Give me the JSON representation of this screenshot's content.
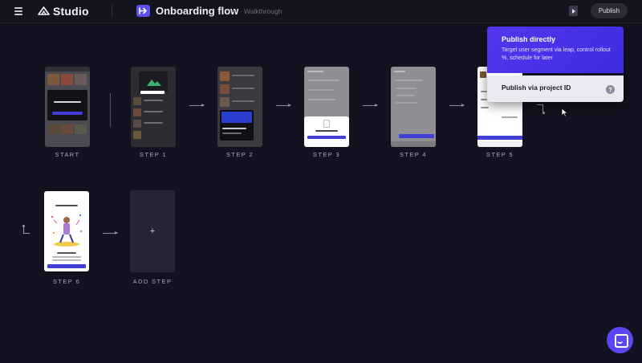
{
  "app": {
    "brand": "Studio",
    "flow_title": "Onboarding flow",
    "flow_type": "Walkthrough",
    "publish_label": "Publish"
  },
  "steps": [
    {
      "label": "START"
    },
    {
      "label": "STEP 1"
    },
    {
      "label": "STEP 2"
    },
    {
      "label": "STEP 3"
    },
    {
      "label": "STEP 4"
    },
    {
      "label": "STEP 5"
    },
    {
      "label": "STEP 6"
    }
  ],
  "add_step_label": "ADD STEP",
  "add_step_icon": "+",
  "publish_menu": {
    "direct_title": "Publish directly",
    "direct_desc": "Target user segment via leap, control rollout %, schedule for later",
    "project_title": "Publish via project ID",
    "help_glyph": "?"
  },
  "colors": {
    "background": "#121220",
    "accent": "#5b46f2",
    "menu_primary": "#4a34e8",
    "menu_secondary": "#e9e9f2"
  },
  "icons": [
    "hamburger-icon",
    "studio-logo-icon",
    "flow-icon",
    "play-icon",
    "help-icon",
    "cursor-icon",
    "chat-icon"
  ]
}
